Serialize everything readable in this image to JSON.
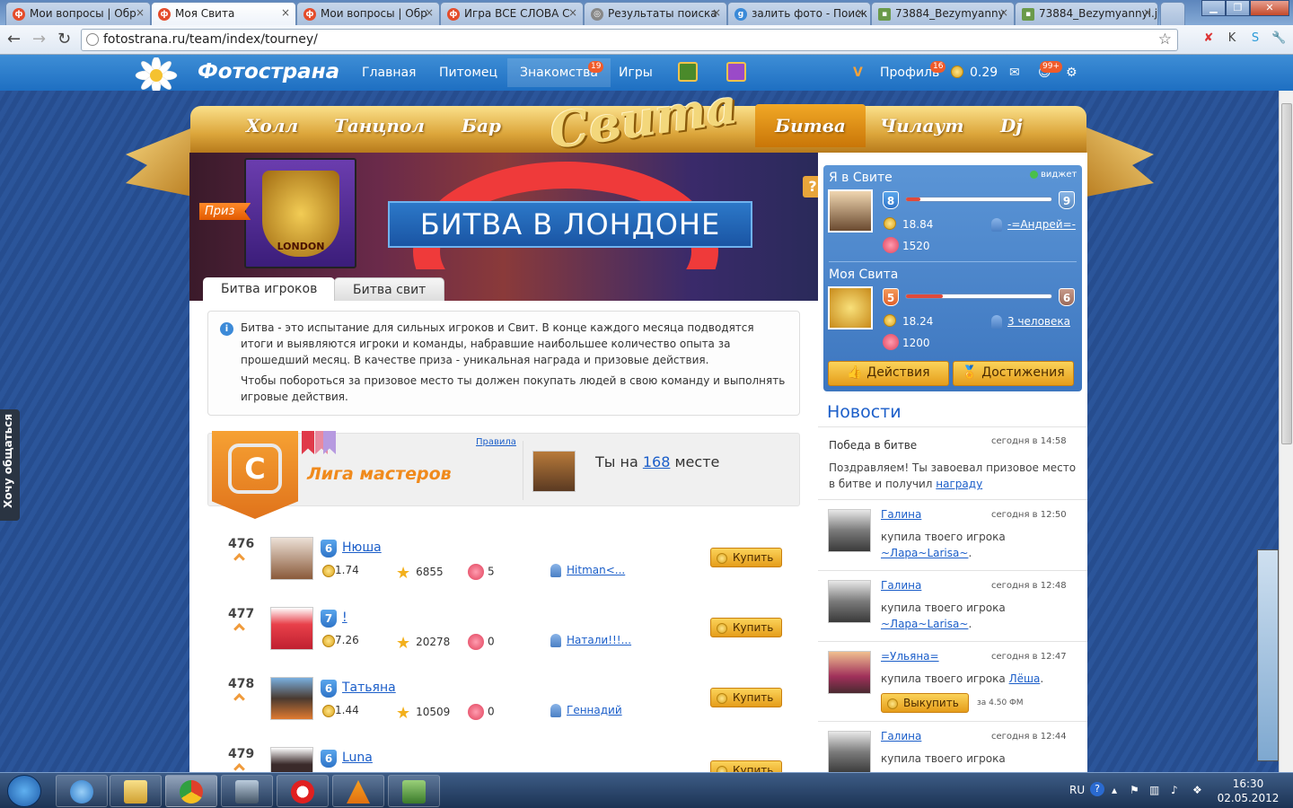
{
  "browser": {
    "tabs": [
      {
        "title": "Мои вопросы | Обр"
      },
      {
        "title": "Моя Свита"
      },
      {
        "title": "Мои вопросы | Обр"
      },
      {
        "title": "Игра ВСЕ СЛОВА С"
      },
      {
        "title": "Результаты поиска"
      },
      {
        "title": "залить фото - Поиск"
      },
      {
        "title": "73884_Bezymyanny"
      },
      {
        "title": "73884_Bezymyannyi.j"
      }
    ],
    "url": "fotostrana.ru/team/index/tourney/"
  },
  "site": {
    "logo": "Фотострана",
    "nav": [
      "Главная",
      "Питомец",
      "Знакомства",
      "Игры"
    ],
    "dating_badge": "19",
    "profile": "Профиль",
    "profile_badge": "16",
    "balance": "0.29",
    "notif_badge": "99+"
  },
  "svita": {
    "logo": "Свита",
    "tabs": [
      "Холл",
      "Танцпол",
      "Бар",
      "Битва",
      "Чилаут",
      "Dj"
    ]
  },
  "banner": {
    "prize_label": "Приз",
    "prize_crest": "LONDON",
    "title": "БИТВА В ЛОНДОНЕ",
    "help": "?"
  },
  "content_tabs": [
    "Битва игроков",
    "Битва свит"
  ],
  "info": {
    "p1": "Битва - это испытание для сильных игроков и Свит. В конце каждого месяца подводятся итоги и выявляются игроки и команды, набравшие наибольшее количество опыта за прошедший месяц. В качестве приза - уникальная награда и призовые действия.",
    "p2": "Чтобы побороться за призовое место ты должен покупать людей в свою команду и выполнять игровые действия."
  },
  "league": {
    "name": "Лига мастеров",
    "rules": "Правила",
    "place_prefix": "Ты на ",
    "place": "168",
    "place_suffix": " месте"
  },
  "players": [
    {
      "rank": "476",
      "level": "6",
      "name": "Нюша",
      "coins": "1.74",
      "stars": "6855",
      "hearts": "5",
      "owner": "Hitman<...",
      "buy": "Купить"
    },
    {
      "rank": "477",
      "level": "7",
      "name": "!",
      "coins": "7.26",
      "stars": "20278",
      "hearts": "0",
      "owner": "Натали!!!...",
      "buy": "Купить"
    },
    {
      "rank": "478",
      "level": "6",
      "name": "Татьяна",
      "coins": "1.44",
      "stars": "10509",
      "hearts": "0",
      "owner": "Геннадий",
      "buy": "Купить"
    },
    {
      "rank": "479",
      "level": "6",
      "name": "Luna",
      "coins": "",
      "stars": "",
      "hearts": "",
      "owner": "",
      "buy": "Купить"
    }
  ],
  "me": {
    "title": "Я в Свите",
    "widget": "виджет",
    "level": "8",
    "next_level": "9",
    "progress": 0.1,
    "coins": "18.84",
    "rating": "1520",
    "owner": "-=Андрей=-"
  },
  "team": {
    "title": "Моя Свита",
    "level": "5",
    "next_level": "6",
    "progress": 0.25,
    "coins": "18.24",
    "rating": "1200",
    "members": "3 человека"
  },
  "actions": {
    "actions": "Действия",
    "achievements": "Достижения"
  },
  "news": {
    "title": "Новости",
    "items": [
      {
        "author": "Победа в битве",
        "time": "сегодня в 14:58",
        "text": "Поздравляем! Ты завоевал призовое место в битве и получил ",
        "link": "награду"
      },
      {
        "author": "Галина",
        "time": "сегодня в 12:50",
        "text": "купила твоего игрока ",
        "link": "~Лара~Larisa~"
      },
      {
        "author": "Галина",
        "time": "сегодня в 12:48",
        "text": "купила твоего игрока ",
        "link": "~Лара~Larisa~"
      },
      {
        "author": "=Ульяна=",
        "time": "сегодня в 12:47",
        "text": "купила твоего игрока ",
        "link": "Лёша"
      },
      {
        "author": "Галина",
        "time": "сегодня в 12:44",
        "text": "купила твоего игрока",
        "link": ""
      }
    ],
    "ransom": "Выкупить",
    "ransom_price": "за 4.50 ФМ"
  },
  "sidebar_tab": "Хочу общаться",
  "taskbar": {
    "lang": "RU",
    "time": "16:30",
    "date": "02.05.2012"
  }
}
